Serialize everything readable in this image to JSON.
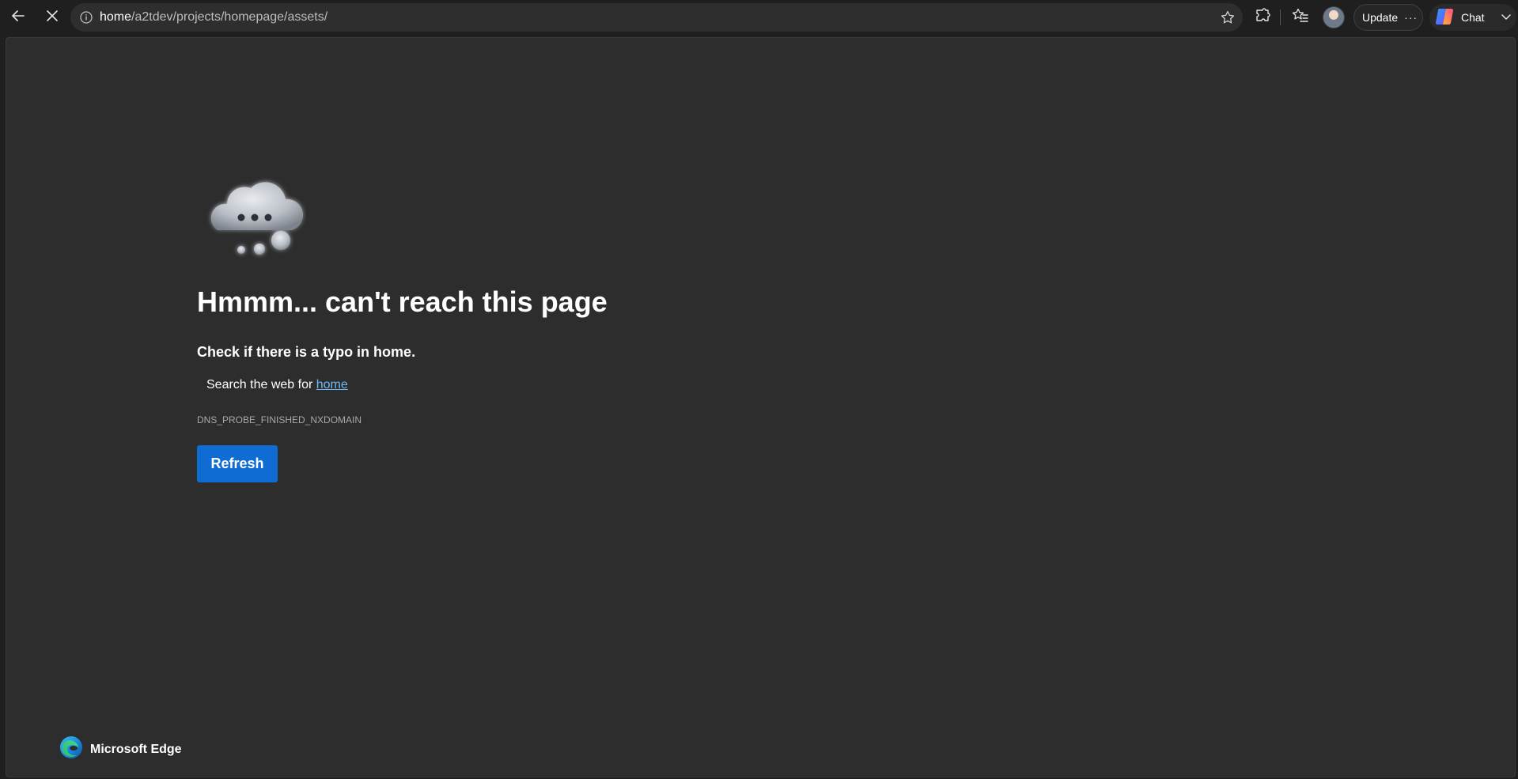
{
  "toolbar": {
    "back_icon": "back-arrow-icon",
    "stop_icon": "close-icon",
    "address": {
      "info_icon": "info-icon",
      "host": "home",
      "path": "/a2tdev/projects/homepage/assets/",
      "favorite_icon": "star-icon"
    },
    "extensions_icon": "puzzle-icon",
    "favorites_icon": "favorites-list-icon",
    "update_label": "Update",
    "more_label": "···",
    "chat_label": "Chat"
  },
  "error_page": {
    "title": "Hmmm... can't reach this page",
    "subtitle": "Check if there is a typo in home.",
    "search_prefix": "Search the web for",
    "search_term": "home",
    "error_code": "DNS_PROBE_FINISHED_NXDOMAIN",
    "refresh_label": "Refresh"
  },
  "footer": {
    "brand_name": "Microsoft Edge"
  },
  "colors": {
    "page_bg": "#2d2d2d",
    "chrome_bg": "#1f1f1f",
    "accent_button": "#0f6cd2",
    "link": "#6cb8f6"
  }
}
